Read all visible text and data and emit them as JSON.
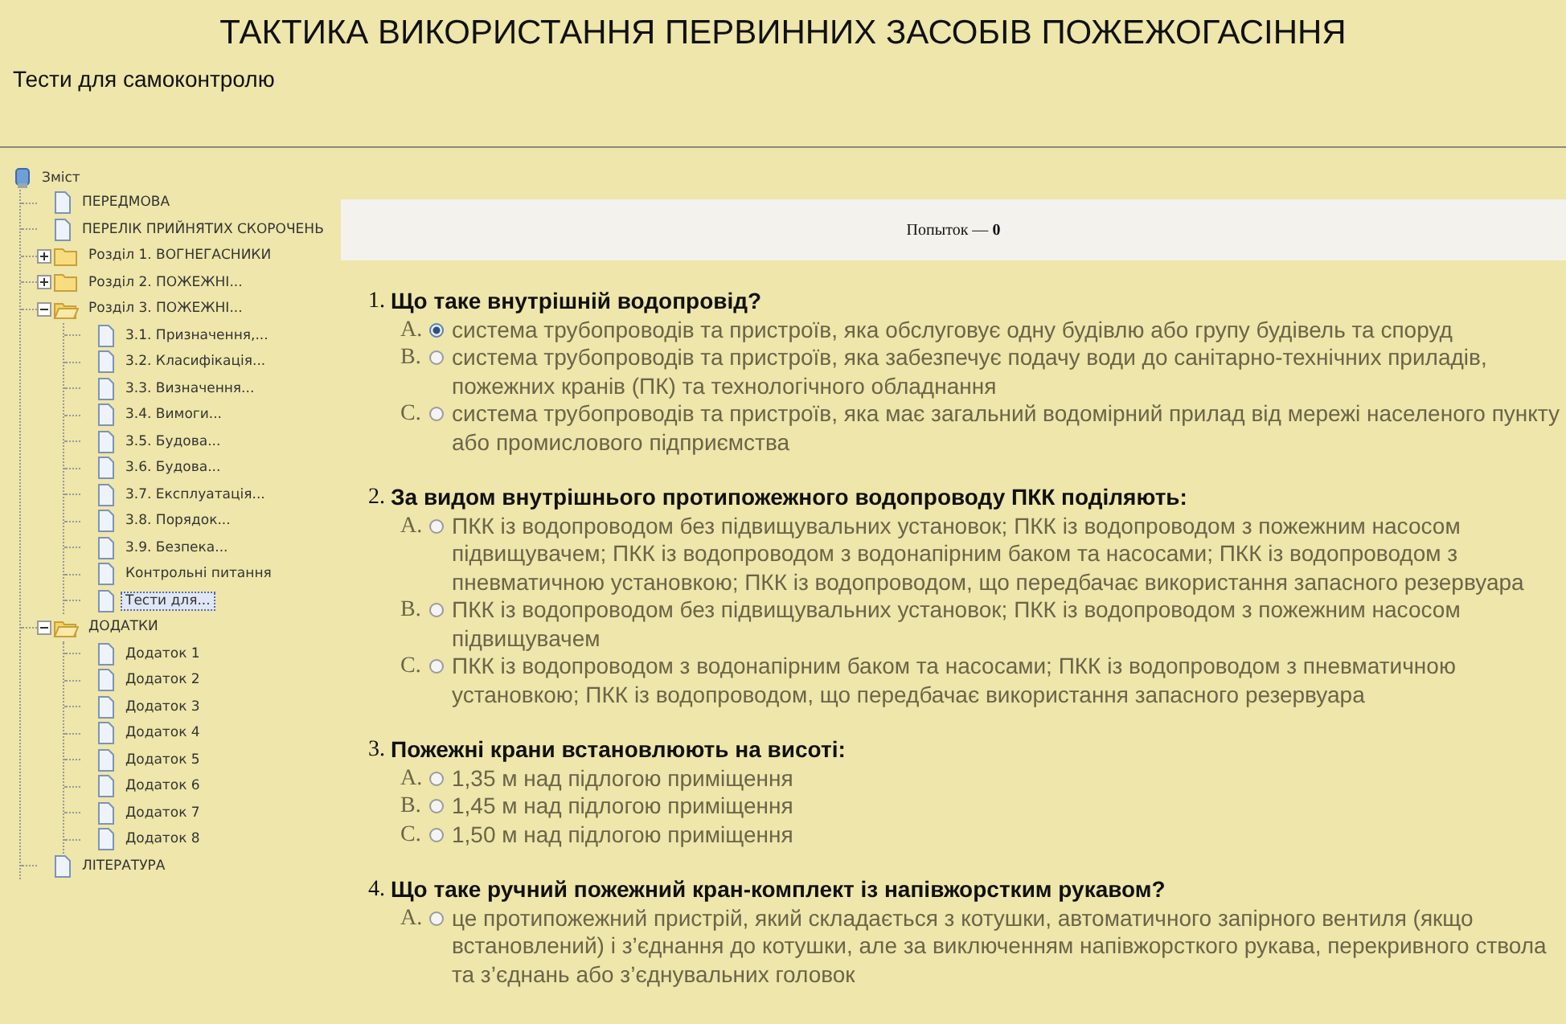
{
  "header": {
    "title": "ТАКТИКА ВИКОРИСТАННЯ ПЕРВИННИХ ЗАСОБІВ ПОЖЕЖОГАСІННЯ",
    "subtitle": "Тести для самоконтролю"
  },
  "tree": {
    "root": "Зміст",
    "items": [
      {
        "label": "ПЕРЕДМОВА",
        "kind": "page",
        "selected": false
      },
      {
        "label": "ПЕРЕЛІК ПРИЙНЯТИХ СКОРОЧЕНЬ",
        "kind": "page",
        "selected": false
      },
      {
        "label": "Розділ 1. ВОГНЕГАСНИКИ",
        "kind": "folder",
        "expanded": false,
        "selected": false
      },
      {
        "label": "Розділ 2. ПОЖЕЖНІ...",
        "kind": "folder",
        "expanded": false,
        "selected": false
      },
      {
        "label": "Розділ 3. ПОЖЕЖНІ...",
        "kind": "folder",
        "expanded": true,
        "selected": false,
        "children": [
          {
            "label": "3.1. Призначення,...",
            "kind": "page",
            "selected": false
          },
          {
            "label": "3.2. Класифікація...",
            "kind": "page",
            "selected": false
          },
          {
            "label": "3.3. Визначення...",
            "kind": "page",
            "selected": false
          },
          {
            "label": "3.4. Вимоги...",
            "kind": "page",
            "selected": false
          },
          {
            "label": "3.5. Будова...",
            "kind": "page",
            "selected": false
          },
          {
            "label": "3.6. Будова...",
            "kind": "page",
            "selected": false
          },
          {
            "label": "3.7. Експлуатація...",
            "kind": "page",
            "selected": false
          },
          {
            "label": "3.8. Порядок...",
            "kind": "page",
            "selected": false
          },
          {
            "label": "3.9. Безпека...",
            "kind": "page",
            "selected": false
          },
          {
            "label": "Контрольні питання",
            "kind": "page",
            "selected": false
          },
          {
            "label": "Тести для...",
            "kind": "page",
            "selected": true
          }
        ]
      },
      {
        "label": "ДОДАТКИ",
        "kind": "folder",
        "expanded": true,
        "selected": false,
        "children": [
          {
            "label": "Додаток 1",
            "kind": "page",
            "selected": false
          },
          {
            "label": "Додаток 2",
            "kind": "page",
            "selected": false
          },
          {
            "label": "Додаток 3",
            "kind": "page",
            "selected": false
          },
          {
            "label": "Додаток 4",
            "kind": "page",
            "selected": false
          },
          {
            "label": "Додаток 5",
            "kind": "page",
            "selected": false
          },
          {
            "label": "Додаток 6",
            "kind": "page",
            "selected": false
          },
          {
            "label": "Додаток 7",
            "kind": "page",
            "selected": false
          },
          {
            "label": "Додаток 8",
            "kind": "page",
            "selected": false
          }
        ]
      },
      {
        "label": "ЛІТЕРАТУРА",
        "kind": "page",
        "selected": false
      }
    ]
  },
  "attempts": {
    "label": "Попыток — ",
    "count": "0"
  },
  "questions": [
    {
      "number": "1.",
      "text": "Що таке внутрішній водопровід?",
      "answers": [
        {
          "letter": "A.",
          "text": "система трубопроводів та пристроїв, яка обслуговує одну будівлю або групу будівель та споруд",
          "selected": true
        },
        {
          "letter": "B.",
          "text": "система трубопроводів та пристроїв, яка забезпечує подачу води до санітарно-технічних приладів, пожежних кранів (ПК) та технологічного обладнання",
          "selected": false
        },
        {
          "letter": "C.",
          "text": "система трубопроводів та пристроїв, яка має загальний водомірний прилад від мережі населеного пункту або промислового підприємства",
          "selected": false
        }
      ]
    },
    {
      "number": "2.",
      "text": "За видом внутрішнього протипожежного водопроводу ПКК поділяють:",
      "answers": [
        {
          "letter": "A.",
          "text": "ПКК із водопроводом без підвищувальних установок; ПКК із водопроводом з пожежним насосом підвищувачем; ПКК із водопроводом з водонапірним баком та насосами; ПКК із водопроводом з пневматичною установкою; ПКК із водопроводом, що передбачає використання запасного резервуара",
          "selected": false
        },
        {
          "letter": "B.",
          "text": "ПКК із водопроводом без підвищувальних установок; ПКК із водопроводом з пожежним насосом підвищувачем",
          "selected": false
        },
        {
          "letter": "C.",
          "text": "ПКК із водопроводом з водонапірним баком та насосами; ПКК із водопроводом з пневматичною установкою; ПКК із водопроводом, що передбачає використання запасного резервуара",
          "selected": false
        }
      ]
    },
    {
      "number": "3.",
      "text": "Пожежні крани встановлюють на висоті:",
      "answers": [
        {
          "letter": "A.",
          "text": "1,35 м над підлогою приміщення",
          "selected": false
        },
        {
          "letter": "B.",
          "text": "1,45 м над підлогою приміщення",
          "selected": false
        },
        {
          "letter": "C.",
          "text": "1,50 м над підлогою приміщення",
          "selected": false
        }
      ]
    },
    {
      "number": "4.",
      "text": "Що таке ручний пожежний кран-комплект із напівжорстким рукавом?",
      "answers": [
        {
          "letter": "A.",
          "text": "це протипожежний пристрій, який складається з котушки, автоматичного запірного вентиля (якщо встановлений) і з’єднання до котушки, але за виключенням напівжорсткого рукава, перекривного ствола та з’єднань або з’єднувальних головок",
          "selected": false
        }
      ]
    }
  ]
}
